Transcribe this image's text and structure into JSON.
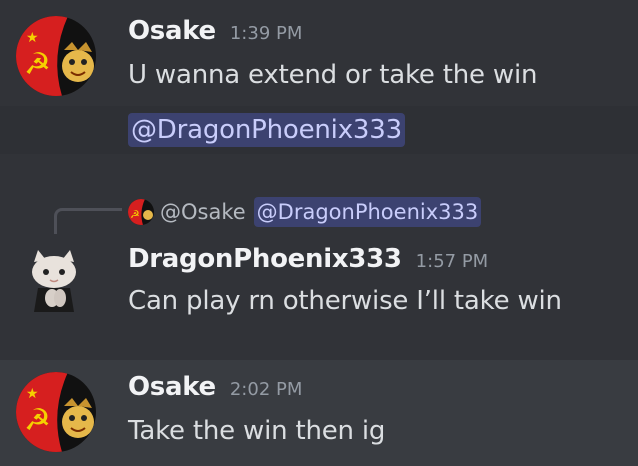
{
  "messages": [
    {
      "author": "Osake",
      "timestamp": "1:39 PM",
      "lines": [
        "U wanna extend or take the win"
      ],
      "mention": "@DragonPhoenix333"
    },
    {
      "reply": {
        "author": "@Osake",
        "mention": "@DragonPhoenix333"
      },
      "author": "DragonPhoenix333",
      "timestamp": "1:57 PM",
      "lines": [
        "Can play rn otherwise I’ll take win"
      ]
    },
    {
      "author": "Osake",
      "timestamp": "2:02 PM",
      "lines": [
        "Take the win then ig"
      ]
    }
  ],
  "colors": {
    "background": "#313338",
    "hover_row": "#2e3035",
    "selected_row": "#393c41",
    "mention_bg": "#3c4270",
    "mention_text": "#c9cdfb"
  },
  "icons": {
    "osake_avatar": "soviet-flag-avatar",
    "dragon_avatar": "cat-avatar"
  }
}
